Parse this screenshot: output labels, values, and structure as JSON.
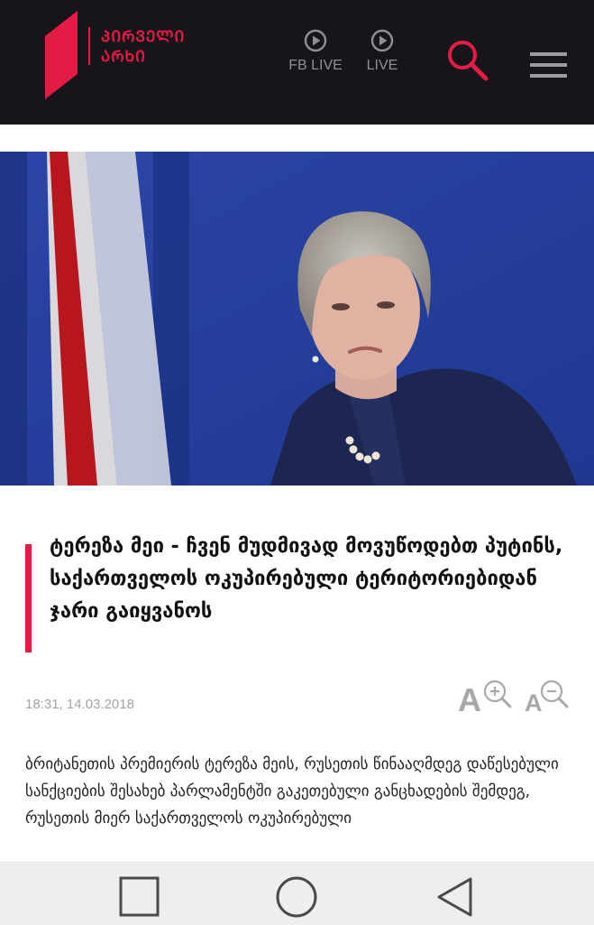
{
  "header": {
    "logo_line1": "ᲞᲘᲠᲕᲔᲚᲘ",
    "logo_line2": "ᲐᲠᲮᲘ",
    "fb_live_label": "FB LIVE",
    "live_label": "LIVE",
    "accent_color": "#e31b45",
    "background_color": "#17141a"
  },
  "article": {
    "headline": "ტერეზა მეი - ჩვენ მუდმივად მოვუწოდებთ პუტინს, საქართველოს ოკუპირებული ტერიტორიებიდან ჯარი გაიყვანოს",
    "datetime": "18:31, 14.03.2018",
    "body": "ბრიტანეთის პრემიერის ტერეზა მეის, რუსეთის წინააღმდეგ დაწესებული სანქციების შესახებ პარლამენტში გაკეთებული განცხადების შემდეგ, რუსეთის მიერ საქართველოს ოკუპირებული"
  },
  "icons": {
    "logo": "channel-logo-icon",
    "fb_live": "play-circle-icon",
    "live": "play-circle-icon",
    "search": "search-icon",
    "menu": "hamburger-menu-icon",
    "font_increase": "text-zoom-in-icon",
    "font_decrease": "text-zoom-out-icon",
    "nav_recents": "square-icon",
    "nav_home": "circle-icon",
    "nav_back": "triangle-back-icon"
  }
}
